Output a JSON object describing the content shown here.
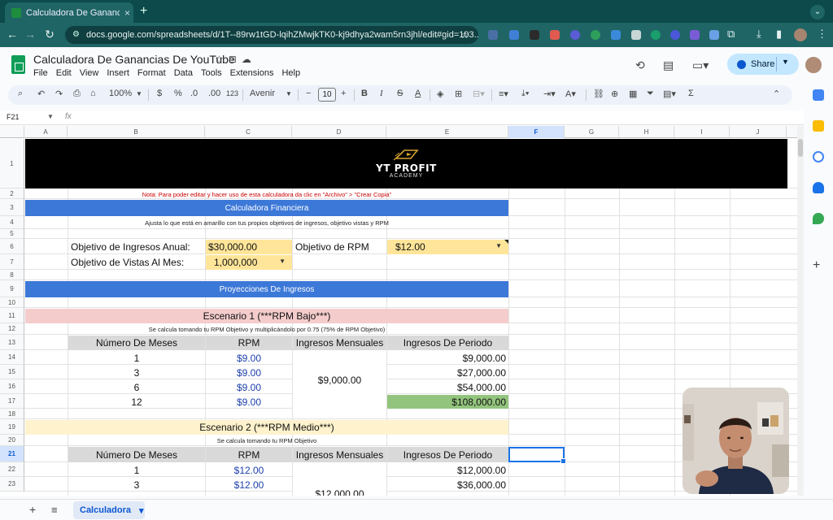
{
  "browser": {
    "tab_title": "Calculadora De Ganancias De",
    "tab_close": "×",
    "new_tab": "+",
    "url": "docs.google.com/spreadsheets/d/1T--89rw1tGD-lqihZMwjkTK0-kj9dhya2wam5rn3jhl/edit#gid=103..."
  },
  "sheets": {
    "doc_title": "Calculadora De Ganancias De YouTube",
    "menus": [
      "File",
      "Edit",
      "View",
      "Insert",
      "Format",
      "Data",
      "Tools",
      "Extensions",
      "Help"
    ],
    "share_label": "Share"
  },
  "toolbar": {
    "zoom": "100%",
    "currency": "$",
    "percent": "%",
    "dec_decrease": ".0",
    "dec_increase": ".00",
    "number_format": "123",
    "font": "Avenir",
    "font_size": "10",
    "bold": "B",
    "italic": "I",
    "strike": "S",
    "text_color": "A",
    "functions": "Σ"
  },
  "formula_bar": {
    "name_box": "F21",
    "fx": "fx"
  },
  "grid": {
    "columns": [
      "A",
      "B",
      "C",
      "D",
      "E",
      "F",
      "G",
      "H",
      "I",
      "J"
    ],
    "selected_column": "F",
    "rows": [
      "1",
      "2",
      "3",
      "4",
      "5",
      "6",
      "7",
      "8",
      "9",
      "10",
      "11",
      "12",
      "13",
      "14",
      "15",
      "16",
      "17",
      "18",
      "19",
      "20",
      "21",
      "22",
      "23"
    ],
    "selected_row": "21"
  },
  "banner": {
    "title": "YT PROFIT",
    "subtitle": "ACADEMY"
  },
  "content": {
    "note": "Nota: Para poder editar y hacer uso de esta calculadora da clic en \"Archivo\" > \"Crear Copia\"",
    "calc_header": "Calculadora Financiera",
    "calc_sub": "Ajusta lo que está en amarillo con tus propios objetivos de ingresos, objetivo vistas y RPM",
    "income_label": "Objetivo de Ingresos Anual:",
    "income_value": "$30,000.00",
    "rpm_label": "Objetivo de RPM",
    "rpm_value": "$12.00",
    "views_label": "Objetivo de Vistas Al Mes:",
    "views_value": "1,000,000",
    "proj_header": "Proyecciones De Ingresos",
    "s1_title": "Escenario 1 (***RPM Bajo***)",
    "s1_sub": "Se calcula tomando tu RPM Objetivo y multiplicándolo por 0.75 (75% de RPM Objetivo)",
    "table_headers": [
      "Número De Meses",
      "RPM",
      "Ingresos Mensuales",
      "Ingresos De Periodo"
    ],
    "s1_rows": [
      {
        "months": "1",
        "rpm": "$9.00",
        "period": "$9,000.00"
      },
      {
        "months": "3",
        "rpm": "$9.00",
        "period": "$27,000.00"
      },
      {
        "months": "6",
        "rpm": "$9.00",
        "period": "$54,000.00"
      },
      {
        "months": "12",
        "rpm": "$9.00",
        "period": "$108,000.00"
      }
    ],
    "s1_monthly": "$9,000.00",
    "s2_title": "Escenario 2 (***RPM Medio***)",
    "s2_sub": "Se calcula tomando tu RPM Objetivo",
    "s2_rows": [
      {
        "months": "1",
        "rpm": "$12.00",
        "period": "$12,000.00"
      },
      {
        "months": "3",
        "rpm": "$12.00",
        "period": "$36,000.00"
      }
    ],
    "s2_monthly": "$12,000.00"
  },
  "bottom": {
    "add_sheet": "+",
    "all_sheets": "≡",
    "sheet_tab": "Calculadora",
    "sheet_tab_arrow": "▾"
  },
  "colors": {
    "header_blue": "#3c78d8",
    "input_yellow": "#ffe599",
    "scenario1_pink": "#f4cccc",
    "scenario2_cream": "#fff2cc",
    "highlight_green": "#93c47d",
    "rpm_blue_text": "#1c3faa",
    "note_red": "#cc0000"
  }
}
